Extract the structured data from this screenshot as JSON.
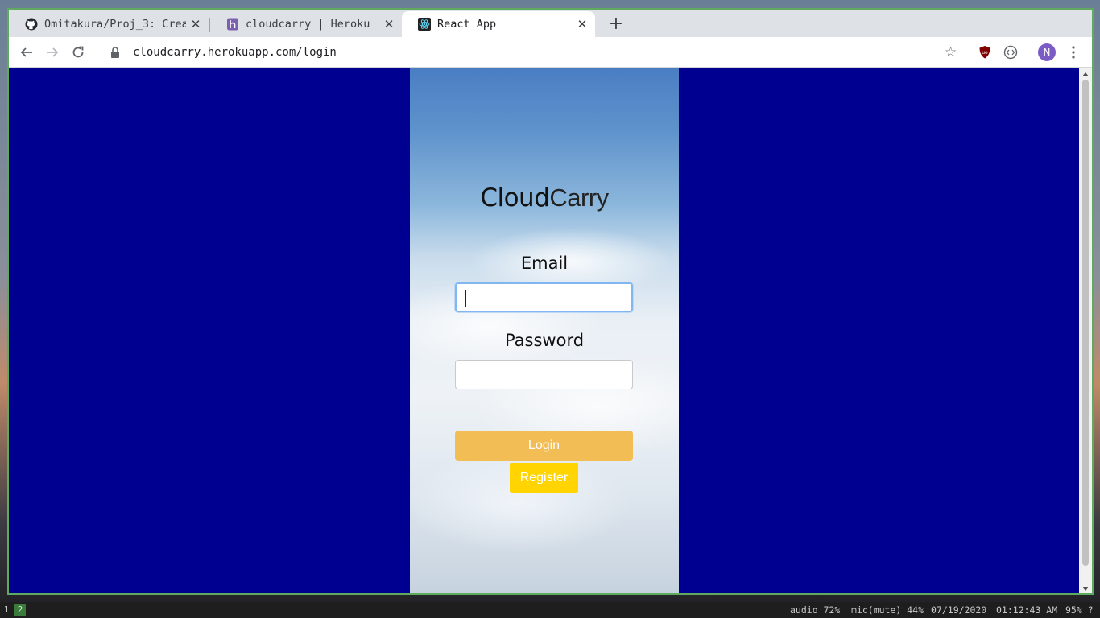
{
  "browser": {
    "tabs": [
      {
        "title": "Omitakura/Proj_3: Crea",
        "icon": "github-icon"
      },
      {
        "title": "cloudcarry | Heroku",
        "icon": "heroku-icon"
      },
      {
        "title": "React App",
        "icon": "react-icon",
        "active": true
      }
    ],
    "new_tab_label": "+",
    "url": "cloudcarry.herokuapp.com/login",
    "profile_initial": "N"
  },
  "page": {
    "logo_part1": "Cloud",
    "logo_part2": "Carry",
    "email_label": "Email",
    "email_value": "",
    "password_label": "Password",
    "password_value": "",
    "login_label": "Login",
    "register_label": "Register",
    "background_color": "#000090",
    "login_color": "#f2bd55",
    "register_color": "#ffd400"
  },
  "taskbar": {
    "workspaces": [
      "1",
      "2"
    ],
    "audio": "audio 72%",
    "mic": "mic(mute) 44%",
    "date": "07/19/2020",
    "time": "01:12:43 AM",
    "battery": "95% ?"
  }
}
